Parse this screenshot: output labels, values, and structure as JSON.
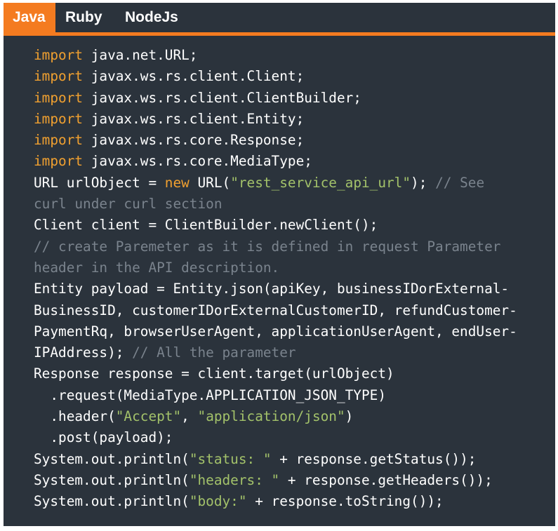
{
  "tabs": [
    {
      "label": "Java",
      "active": true
    },
    {
      "label": "Ruby",
      "active": false
    },
    {
      "label": "NodeJs",
      "active": false
    }
  ],
  "colors": {
    "panel_bg": "#2b333c",
    "accent": "#f47b20",
    "keyword": "#f0a030",
    "string": "#a3c26a",
    "comment": "#7a838d",
    "text": "#ffffff"
  },
  "code_lines": [
    [
      {
        "t": "kw",
        "v": "import"
      },
      {
        "t": "tx",
        "v": " java.net.URL;"
      }
    ],
    [
      {
        "t": "kw",
        "v": "import"
      },
      {
        "t": "tx",
        "v": " javax.ws.rs.client.Client;"
      }
    ],
    [
      {
        "t": "kw",
        "v": "import"
      },
      {
        "t": "tx",
        "v": " javax.ws.rs.client.ClientBuilder;"
      }
    ],
    [
      {
        "t": "kw",
        "v": "import"
      },
      {
        "t": "tx",
        "v": " javax.ws.rs.client.Entity;"
      }
    ],
    [
      {
        "t": "kw",
        "v": "import"
      },
      {
        "t": "tx",
        "v": " javax.ws.rs.core.Response;"
      }
    ],
    [
      {
        "t": "kw",
        "v": "import"
      },
      {
        "t": "tx",
        "v": " javax.ws.rs.core.MediaType;"
      }
    ],
    [
      {
        "t": "tx",
        "v": "URL urlObject = "
      },
      {
        "t": "kw",
        "v": "new"
      },
      {
        "t": "tx",
        "v": " URL("
      },
      {
        "t": "str",
        "v": "\"rest_service_api_url\""
      },
      {
        "t": "tx",
        "v": "); "
      },
      {
        "t": "cm",
        "v": "// See"
      }
    ],
    [
      {
        "t": "cm",
        "v": "curl under curl section"
      }
    ],
    [
      {
        "t": "tx",
        "v": "Client client = ClientBuilder.newClient();"
      }
    ],
    [
      {
        "t": "cm",
        "v": "// create Paremeter as it is defined in request Parameter"
      }
    ],
    [
      {
        "t": "cm",
        "v": "header in the API description."
      }
    ],
    [
      {
        "t": "tx",
        "v": "Entity payload = Entity.json(apiKey, businessIDorExternal-"
      }
    ],
    [
      {
        "t": "tx",
        "v": "BusinessID, customerIDorExternalCustomerID, refundCustomer-"
      }
    ],
    [
      {
        "t": "tx",
        "v": "PaymentRq, browserUserAgent, applicationUserAgent, endUser-"
      }
    ],
    [
      {
        "t": "tx",
        "v": "IPAddress); "
      },
      {
        "t": "cm",
        "v": "// All the parameter"
      }
    ],
    [
      {
        "t": "tx",
        "v": "Response response = client.target(urlObject)"
      }
    ],
    [
      {
        "t": "tx",
        "v": "  .request(MediaType.APPLICATION_JSON_TYPE)"
      }
    ],
    [
      {
        "t": "tx",
        "v": "  .header("
      },
      {
        "t": "str",
        "v": "\"Accept\""
      },
      {
        "t": "tx",
        "v": ", "
      },
      {
        "t": "str",
        "v": "\"application/json\""
      },
      {
        "t": "tx",
        "v": ")"
      }
    ],
    [
      {
        "t": "tx",
        "v": "  .post(payload);"
      }
    ],
    [
      {
        "t": "tx",
        "v": "System.out.println("
      },
      {
        "t": "str",
        "v": "\"status: \""
      },
      {
        "t": "tx",
        "v": " + response.getStatus());"
      }
    ],
    [
      {
        "t": "tx",
        "v": "System.out.println("
      },
      {
        "t": "str",
        "v": "\"headers: \""
      },
      {
        "t": "tx",
        "v": " + response.getHeaders());"
      }
    ],
    [
      {
        "t": "tx",
        "v": "System.out.println("
      },
      {
        "t": "str",
        "v": "\"body:\""
      },
      {
        "t": "tx",
        "v": " + response.toString());"
      }
    ]
  ]
}
